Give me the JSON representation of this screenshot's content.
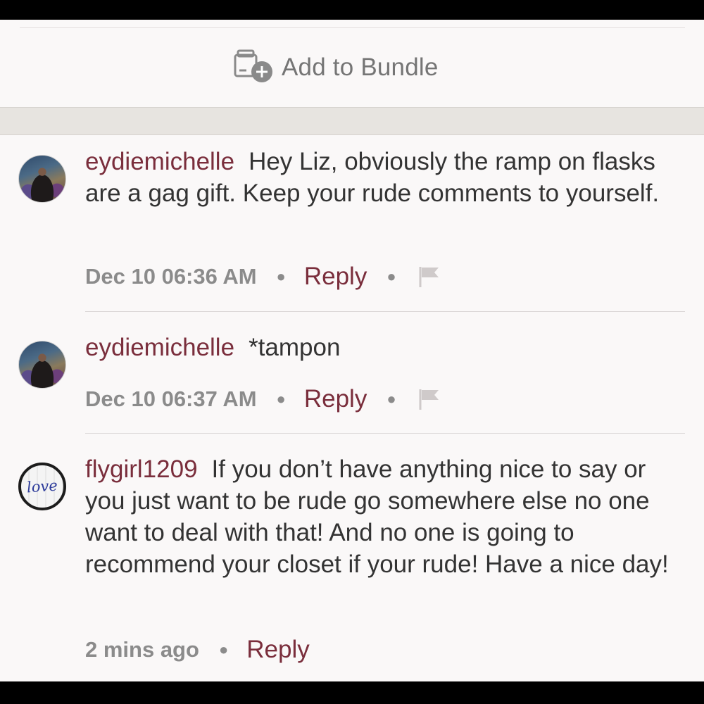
{
  "bundle": {
    "label": "Add to Bundle",
    "icon": "add-to-bundle-icon"
  },
  "colors": {
    "username": "#7a2e3c",
    "reply": "#7a2e3c",
    "meta": "#8b8b8b",
    "text": "#333333"
  },
  "comments": [
    {
      "username": "eydiemichelle",
      "text": "Hey Liz, obviously the ramp on flasks are a gag gift. Keep your rude comments to yourself.",
      "timestamp": "Dec 10 06:36 AM",
      "reply_label": "Reply",
      "has_flag": true
    },
    {
      "username": "eydiemichelle",
      "text": "*tampon",
      "timestamp": "Dec 10 06:37 AM",
      "reply_label": "Reply",
      "has_flag": true
    },
    {
      "username": "flygirl1209",
      "avatar_text": "love",
      "text": "If you don’t have anything nice to say or you just want to be rude go somewhere else no one want to deal with that! And no one is going to recommend your closet if your rude! Have a nice day!",
      "timestamp": "2 mins ago",
      "reply_label": "Reply",
      "has_flag": false
    }
  ]
}
